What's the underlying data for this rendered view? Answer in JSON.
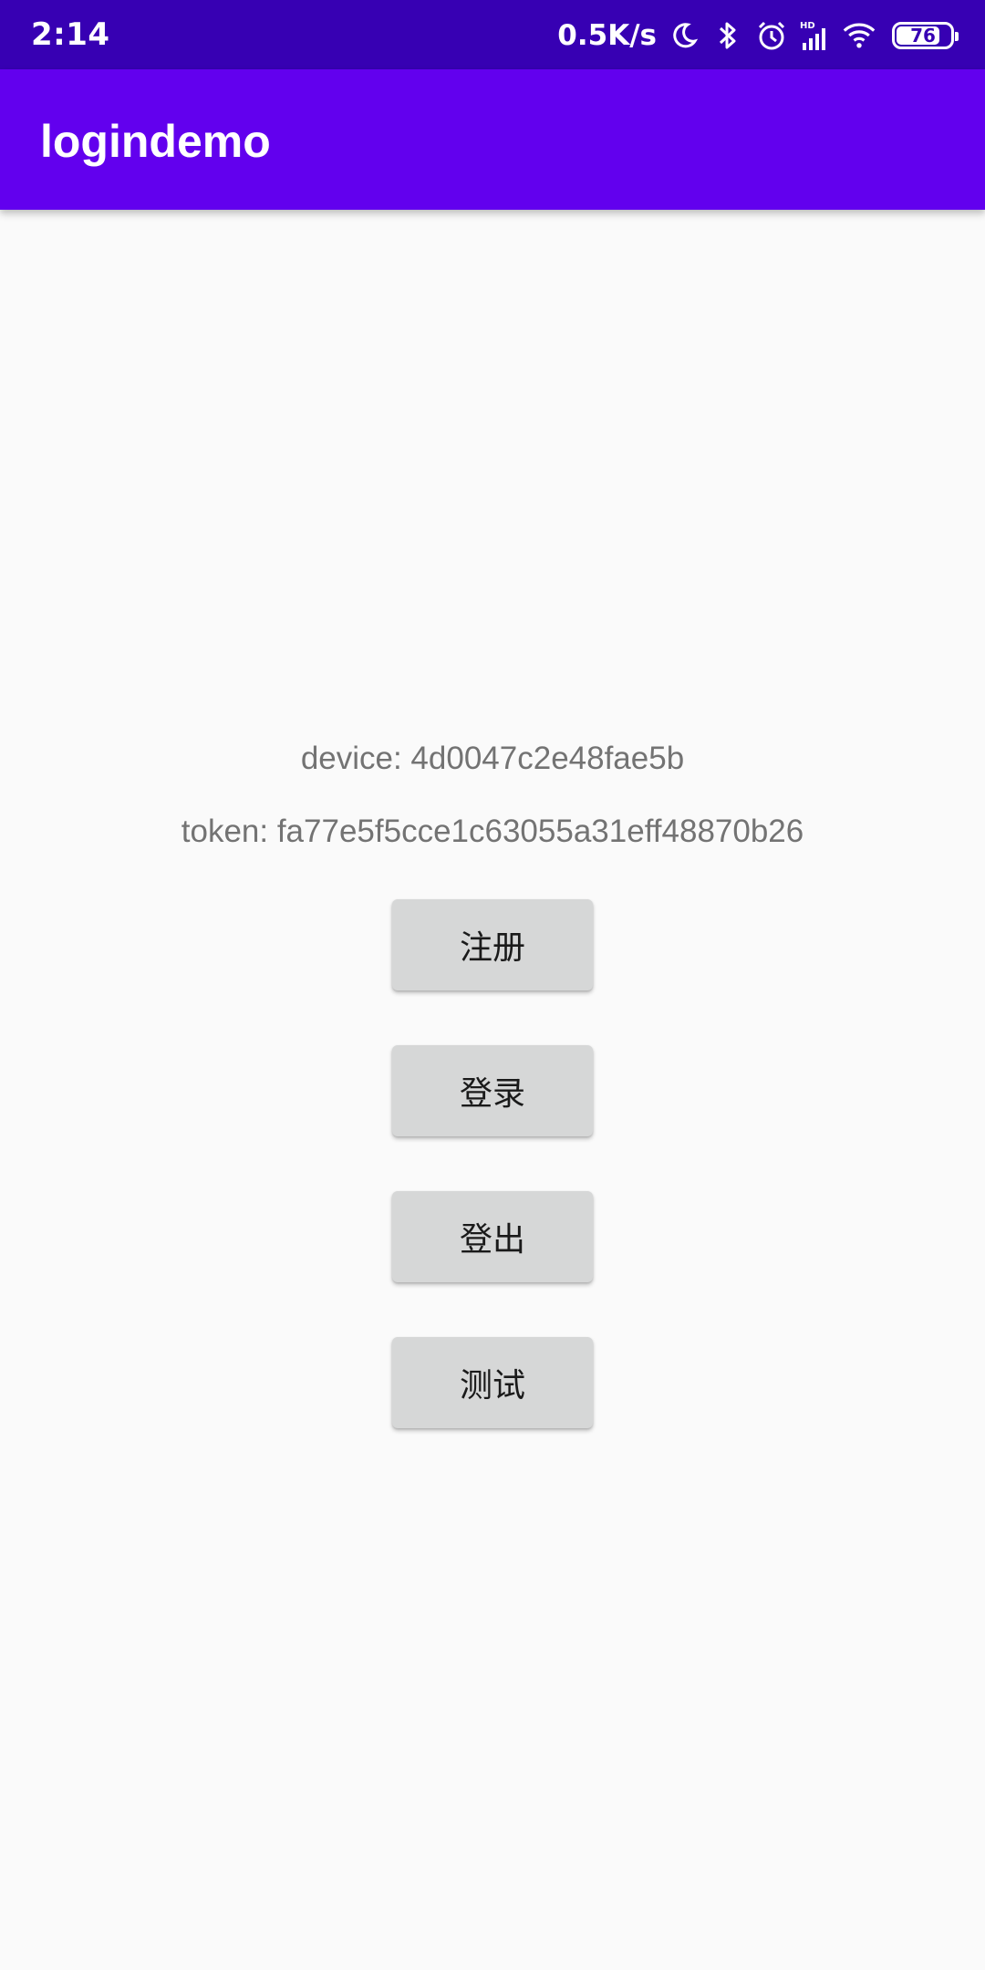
{
  "status_bar": {
    "time": "2:14",
    "net_speed": "0.5K/s",
    "battery_level": "76",
    "icons": [
      "moon-icon",
      "bluetooth-icon",
      "alarm-icon",
      "hd-signal-icon",
      "wifi-icon",
      "battery-icon"
    ],
    "background": "#3700b3"
  },
  "app_bar": {
    "title": "logindemo",
    "background": "#6200ee"
  },
  "info": {
    "device": "device: 4d0047c2e48fae5b",
    "token": "token: fa77e5f5cce1c63055a31eff48870b26"
  },
  "buttons": {
    "register": "注册",
    "login": "登录",
    "logout": "登出",
    "test": "测试"
  }
}
